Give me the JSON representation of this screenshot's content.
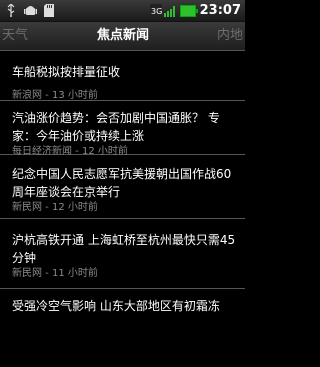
{
  "status": {
    "time": "23:07"
  },
  "tabs": [
    {
      "label": "天气"
    },
    {
      "label": "焦点新闻"
    },
    {
      "label": "内地"
    }
  ],
  "news": [
    {
      "headline": "车船税拟按排量征收",
      "meta": "新浪网 - 13 小时前"
    },
    {
      "headline": "汽油涨价趋势：会否加剧中国通胀？ 专家：今年油价或持续上涨",
      "meta": "每日经济新闻 - 12 小时前"
    },
    {
      "headline": "纪念中国人民志愿军抗美援朝出国作战60周年座谈会在京举行",
      "meta": "新民网 - 12 小时前"
    },
    {
      "headline": "沪杭高铁开通 上海虹桥至杭州最快只需45分钟",
      "meta": "新民网 - 11 小时前"
    },
    {
      "headline": "受强冷空气影响 山东大部地区有初霜冻",
      "meta": ""
    }
  ]
}
